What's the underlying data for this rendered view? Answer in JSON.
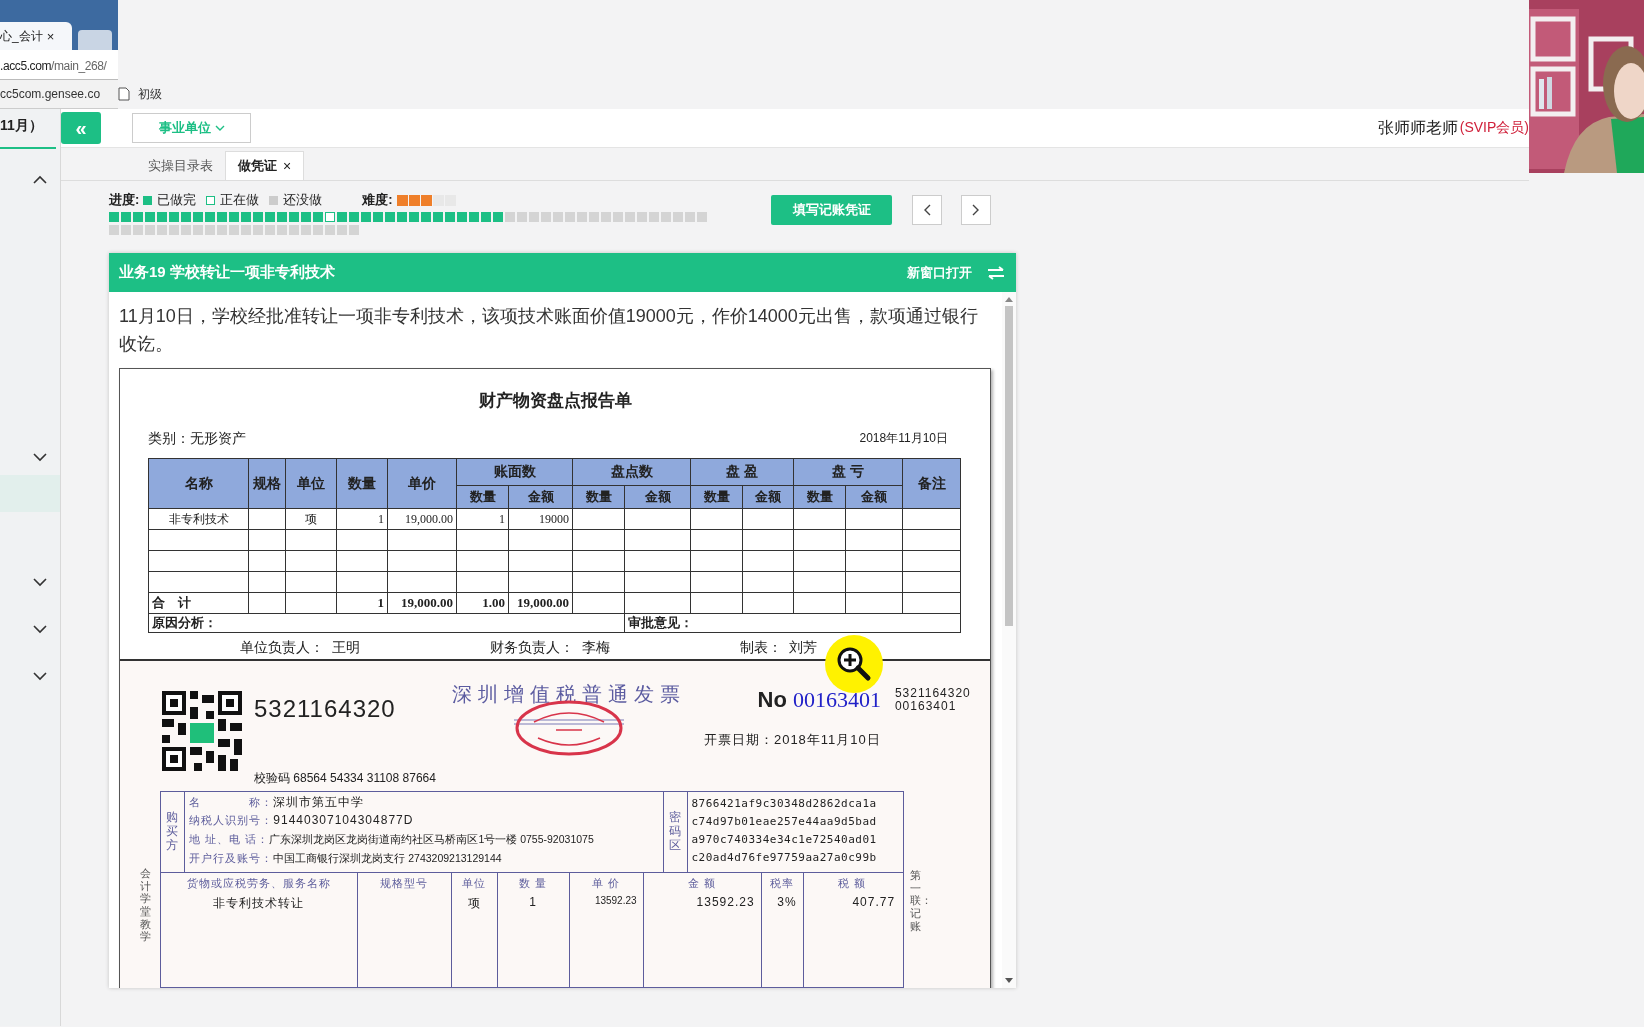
{
  "browser": {
    "tab_title": "心_会计",
    "tab_close": "×",
    "url_domain": ".acc5.com",
    "url_path": "/main_268/",
    "bookmarks": [
      {
        "label": "cc5com.gensee.co",
        "kind": "link"
      },
      {
        "label": "初级",
        "kind": "page"
      }
    ]
  },
  "sidebar": {
    "title": "11月）",
    "items": [
      {
        "kind": "toggle",
        "expanded": true
      },
      {
        "kind": "toggle",
        "expanded": false
      },
      {
        "kind": "row",
        "selected": true
      },
      {
        "kind": "toggle",
        "expanded": false
      },
      {
        "kind": "toggle",
        "expanded": false
      },
      {
        "kind": "toggle",
        "expanded": false
      }
    ]
  },
  "header": {
    "collapse": "«",
    "unit_dropdown": "事业单位",
    "user": "张师师老师",
    "badge": "(SVIP会员)"
  },
  "tabs": [
    {
      "label": "实操目录表",
      "selected": false
    },
    {
      "label": "做凭证",
      "selected": true,
      "close": "×"
    }
  ],
  "progress": {
    "label": "进度:",
    "legend": [
      {
        "kind": "done",
        "label": "已做完"
      },
      {
        "kind": "current",
        "label": "正在做"
      },
      {
        "kind": "todo",
        "label": "还没做"
      }
    ],
    "difficulty_label": "难度:",
    "stars": 3,
    "steps": [
      {
        "done": true,
        "current": false
      },
      {
        "done": true,
        "current": false
      },
      {
        "done": true,
        "current": false
      },
      {
        "done": true,
        "current": false
      },
      {
        "done": true,
        "current": false
      },
      {
        "done": true,
        "current": false
      },
      {
        "done": true,
        "current": false
      },
      {
        "done": true,
        "current": false
      },
      {
        "done": true,
        "current": false
      },
      {
        "done": true,
        "current": false
      },
      {
        "done": true,
        "current": false
      },
      {
        "done": true,
        "current": false
      },
      {
        "done": true,
        "current": false
      },
      {
        "done": true,
        "current": false
      },
      {
        "done": true,
        "current": false
      },
      {
        "done": true,
        "current": false
      },
      {
        "done": true,
        "current": false
      },
      {
        "done": true,
        "current": false
      },
      {
        "done": false,
        "current": true
      },
      {
        "done": true,
        "current": false
      },
      {
        "done": true,
        "current": false
      },
      {
        "done": true,
        "current": false
      },
      {
        "done": true,
        "current": false
      },
      {
        "done": true,
        "current": false
      },
      {
        "done": true,
        "current": false
      },
      {
        "done": true,
        "current": false
      },
      {
        "done": true,
        "current": false
      },
      {
        "done": true,
        "current": false
      },
      {
        "done": true,
        "current": false
      },
      {
        "done": true,
        "current": false
      },
      {
        "done": true,
        "current": false
      },
      {
        "done": true,
        "current": false
      },
      {
        "done": true,
        "current": false
      },
      {
        "done": false,
        "current": false
      },
      {
        "done": false,
        "current": false
      },
      {
        "done": false,
        "current": false
      },
      {
        "done": false,
        "current": false
      },
      {
        "done": false,
        "current": false
      },
      {
        "done": false,
        "current": false
      },
      {
        "done": false,
        "current": false
      },
      {
        "done": false,
        "current": false
      },
      {
        "done": false,
        "current": false
      },
      {
        "done": false,
        "current": false
      },
      {
        "done": false,
        "current": false
      },
      {
        "done": false,
        "current": false
      },
      {
        "done": false,
        "current": false
      },
      {
        "done": false,
        "current": false
      },
      {
        "done": false,
        "current": false
      },
      {
        "done": false,
        "current": false
      },
      {
        "done": false,
        "current": false
      },
      {
        "done": false,
        "current": false
      },
      {
        "done": false,
        "current": false
      },
      {
        "done": false,
        "current": false
      },
      {
        "done": false,
        "current": false
      },
      {
        "done": false,
        "current": false
      },
      {
        "done": false,
        "current": false
      },
      {
        "done": false,
        "current": false
      },
      {
        "done": false,
        "current": false
      },
      {
        "done": false,
        "current": false
      },
      {
        "done": false,
        "current": false
      },
      {
        "done": false,
        "current": false
      },
      {
        "done": false,
        "current": false
      },
      {
        "done": false,
        "current": false
      },
      {
        "done": false,
        "current": false
      },
      {
        "done": false,
        "current": false
      },
      {
        "done": false,
        "current": false
      },
      {
        "done": false,
        "current": false
      },
      {
        "done": false,
        "current": false
      },
      {
        "done": false,
        "current": false
      },
      {
        "done": false,
        "current": false
      },
      {
        "done": false,
        "current": false
      }
    ],
    "fill_button": "填写记账凭证"
  },
  "task": {
    "title": "业务19 学校转让一项非专利技术",
    "open_new_window": "新窗口打开",
    "description": "11月10日，学校经批准转让一项非专利技术，该项技术账面价值19000元，作价14000元出售，款项通过银行收讫。"
  },
  "report": {
    "title": "财产物资盘点报告单",
    "category": "类别：无形资产",
    "date": "2018年11月10日",
    "top_headers": [
      "名称",
      "规格",
      "单位",
      "数量",
      "单价"
    ],
    "group_headers": [
      "账面数",
      "盘点数",
      "盘 盈",
      "盘 亏"
    ],
    "sub_headers": [
      "数量",
      "金额",
      "数量",
      "金额",
      "数量",
      "金额",
      "数量",
      "金额"
    ],
    "remark_header": "备注",
    "rows": [
      {
        "kind": "item",
        "name": "非专利技术",
        "unit": "项",
        "quantity": "1",
        "price": "19,000.00",
        "book_quantity": "1",
        "book_amount": "19000"
      },
      {
        "kind": "blank"
      },
      {
        "kind": "blank"
      },
      {
        "kind": "blank"
      },
      {
        "kind": "total",
        "name": "合　计",
        "quantity": "1",
        "price": "19,000.00",
        "book_quantity": "1.00",
        "book_amount": "19,000.00"
      }
    ],
    "reason_label": "原因分析：",
    "approval_label": "审批意见：",
    "signatures": [
      {
        "label": "单位负责人：",
        "name": "王明"
      },
      {
        "label": "财务负责人：",
        "name": "李梅"
      },
      {
        "label": "制表：",
        "name": "刘芳"
      }
    ]
  },
  "invoice": {
    "code": "5321164320",
    "title": "深圳增值税普通发票",
    "no_label": "No",
    "number": "00163401",
    "code_small": "5321164320",
    "number_small": "00163401",
    "date": "开票日期：2018年11月10日",
    "check_code": "校验码 68564 54334 31108 87664",
    "buyer_label": "购买方",
    "buyer_fields": [
      {
        "label": "名　　　　称：",
        "value": "深圳市第五中学",
        "kind": "large"
      },
      {
        "label": "纳税人识别号：",
        "value": "91440307104304877D",
        "kind": "large"
      },
      {
        "label": "地 址、电 话：",
        "value": "广东深圳龙岗区龙岗街道南约社区马桥南区1号一楼 0755-92031075",
        "kind": "small"
      },
      {
        "label": "开户行及账号：",
        "value": "中国工商银行深圳龙岗支行 2743209213129144",
        "kind": "small"
      }
    ],
    "cipher_label": "密码区",
    "cipher": [
      "8766421af9c30348d2862dca1a",
      "c74d97b01eae257e44aa9d5bad",
      "a970c740334e34c1e72540ad01",
      "c20ad4d76fe97759aa27a0c99b"
    ],
    "item_headers": [
      "货物或应税劳务、服务名称",
      "规格型号",
      "单位",
      "数 量",
      "单 价",
      "金 额",
      "税率",
      "税 额"
    ],
    "items": [
      {
        "name": "非专利技术转让",
        "unit": "项",
        "quantity": "1",
        "price": "13592.23",
        "amount": "13592.23",
        "rate": "3%",
        "tax": "407.77"
      }
    ],
    "left_vertical": "会计学堂教学",
    "right_vertical": "第一联：记账"
  }
}
